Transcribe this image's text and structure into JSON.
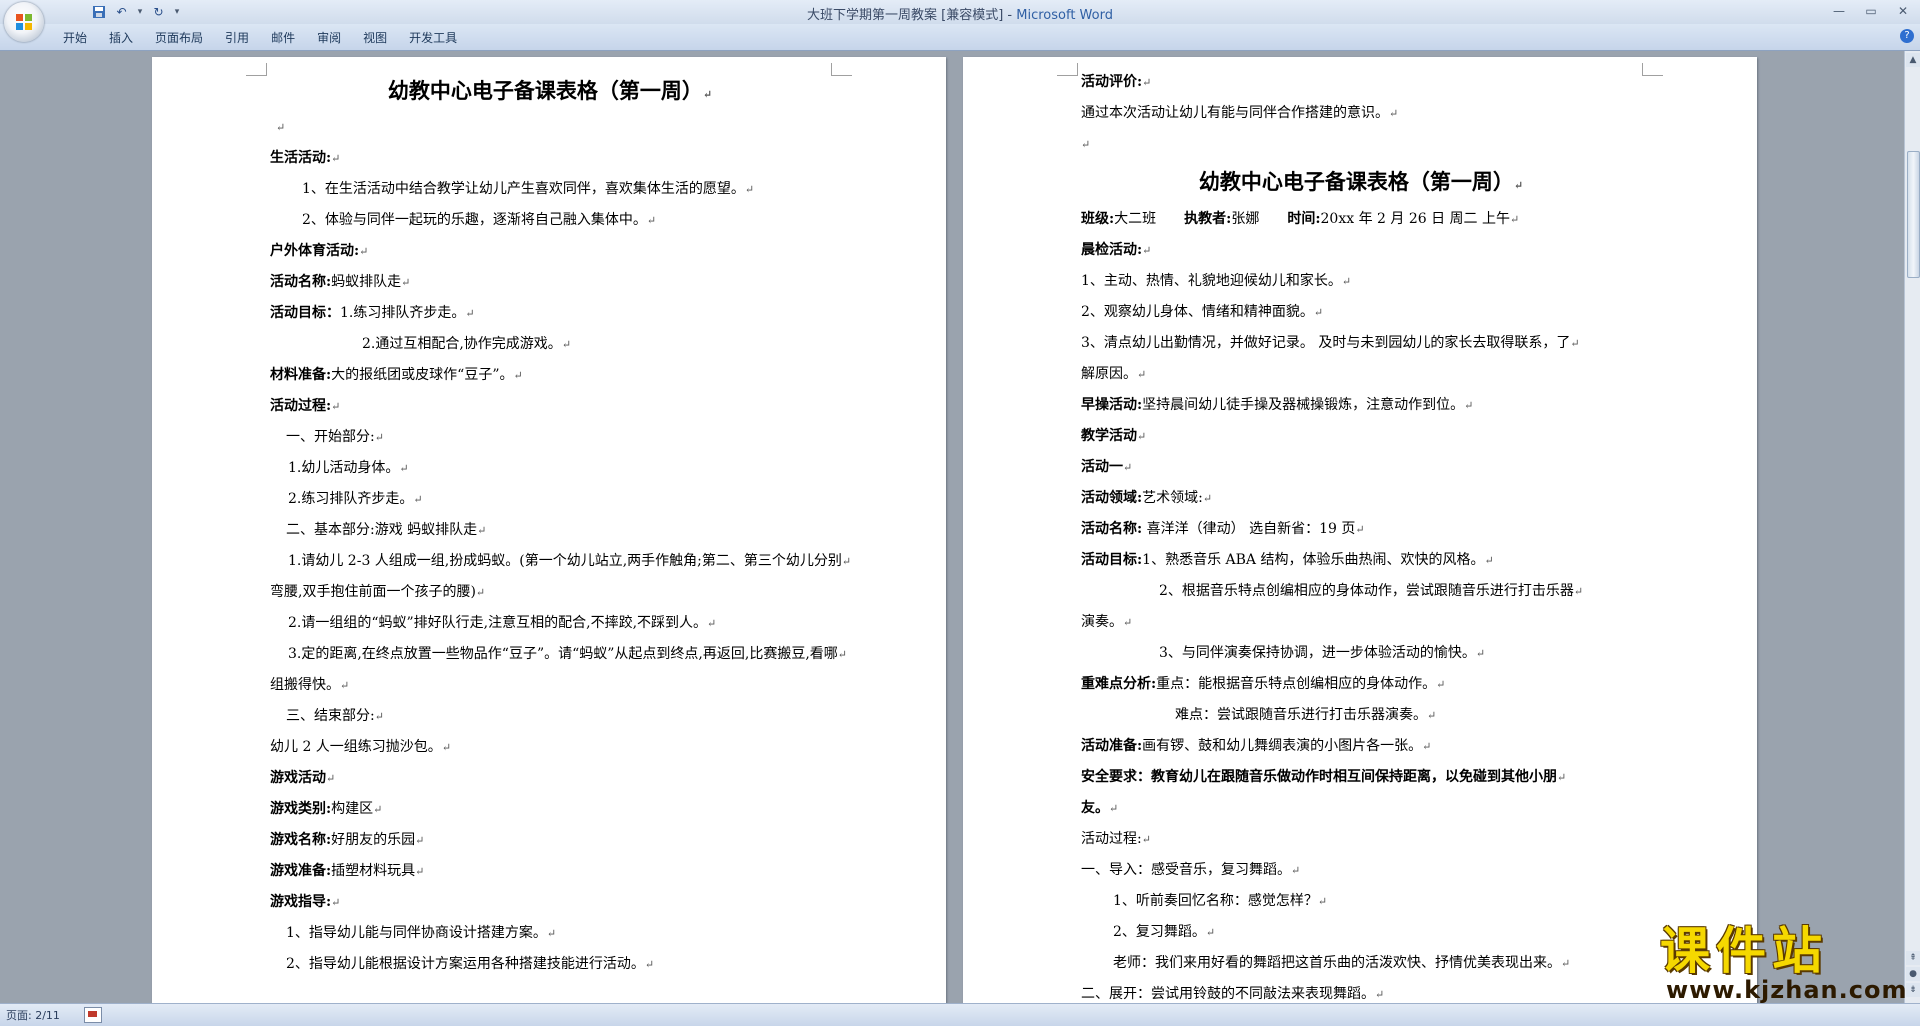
{
  "window": {
    "title_doc": "大班下学期第一周教案 [兼容模式] -",
    "title_app": "Microsoft Word"
  },
  "ribbon": {
    "tabs": [
      "开始",
      "插入",
      "页面布局",
      "引用",
      "邮件",
      "审阅",
      "视图",
      "开发工具"
    ]
  },
  "status": {
    "page": "页面: 2/11"
  },
  "page_left": {
    "title": "幼教中心电子备课表格（第一周）",
    "lines": [
      {
        "t": "",
        "b": false,
        "indent": 6
      },
      {
        "t": "生活活动:",
        "b": true,
        "indent": 0
      },
      {
        "t": "1、在生活活动中结合教学让幼儿产生喜欢同伴，喜欢集体生活的愿望。",
        "b": false,
        "indent": 32
      },
      {
        "t": "2、体验与同伴一起玩的乐趣，逐渐将自己融入集体中。",
        "b": false,
        "indent": 32
      },
      {
        "t": "户外体育活动:",
        "b": true,
        "indent": 0
      },
      {
        "t_b": "活动名称:",
        "t": "蚂蚁排队走",
        "indent": 0
      },
      {
        "t_b": "活动目标：",
        "t": "1.练习排队齐步走。",
        "indent": 0
      },
      {
        "t": "2.通过互相配合,协作完成游戏。",
        "b": false,
        "indent": 92
      },
      {
        "t_b": "材料准备:",
        "t": "大的报纸团或皮球作“豆子”。",
        "indent": 0
      },
      {
        "t": "活动过程:",
        "b": true,
        "indent": 0
      },
      {
        "t": "一、开始部分:",
        "b": false,
        "indent": 16
      },
      {
        "t": "1.幼儿活动身体。",
        "b": false,
        "indent": 18
      },
      {
        "t": "2.练习排队齐步走。",
        "b": false,
        "indent": 18
      },
      {
        "t": "二、基本部分:游戏 蚂蚁排队走",
        "b": false,
        "indent": 16
      },
      {
        "t": "1.请幼儿 2-3 人组成一组,扮成蚂蚁。(第一个幼儿站立,两手作触角;第二、第三个幼儿分别",
        "b": false,
        "indent": 18
      },
      {
        "t": "弯腰,双手抱住前面一个孩子的腰)",
        "b": false,
        "indent": 0
      },
      {
        "t": "2.请一组组的“蚂蚁”排好队行走,注意互相的配合,不摔跤,不踩到人。",
        "b": false,
        "indent": 18
      },
      {
        "t": "3.定的距离,在终点放置一些物品作“豆子”。请“蚂蚁”从起点到终点,再返回,比赛搬豆,看哪",
        "b": false,
        "indent": 18
      },
      {
        "t": "组搬得快。",
        "b": false,
        "indent": 0
      },
      {
        "t": "三、结束部分:",
        "b": false,
        "indent": 16
      },
      {
        "t": "幼儿 2 人一组练习抛沙包。",
        "b": false,
        "indent": 0
      },
      {
        "t": "游戏活动",
        "b": true,
        "indent": 0
      },
      {
        "t_b": "游戏类别:",
        "t": "构建区",
        "indent": 0
      },
      {
        "t_b": "游戏名称:",
        "t": "好朋友的乐园",
        "indent": 0
      },
      {
        "t_b": "游戏准备:",
        "t": "插塑材料玩具",
        "indent": 0
      },
      {
        "t": "游戏指导:",
        "b": true,
        "indent": 0
      },
      {
        "t": "1、指导幼儿能与同伴协商设计搭建方案。",
        "b": false,
        "indent": 16
      },
      {
        "t": "2、指导幼儿能根据设计方案运用各种搭建技能进行活动。",
        "b": false,
        "indent": 16
      }
    ]
  },
  "page_right": {
    "lines_top": [
      {
        "t": "活动评价:",
        "b": true,
        "indent": 0
      },
      {
        "t": "通过本次活动让幼儿有能与同伴合作搭建的意识。",
        "b": false,
        "indent": 0
      },
      {
        "t": "",
        "b": false,
        "indent": 0
      }
    ],
    "title": "幼教中心电子备课表格（第一周）",
    "lines": [
      {
        "t_b": "班级:",
        "t": "大二班",
        "t_b2": "执教者:",
        "t2": "张娜",
        "t_b3": "时间:",
        "t3": "20xx 年 2 月 26 日   周二   上午",
        "indent": 0
      },
      {
        "t": "晨检活动:",
        "b": true,
        "indent": 0
      },
      {
        "t": "1、主动、热情、礼貌地迎候幼儿和家长。",
        "b": false,
        "indent": 0
      },
      {
        "t": "2、观察幼儿身体、情绪和精神面貌。",
        "b": false,
        "indent": 0
      },
      {
        "t": "3、清点幼儿出勤情况，并做好记录。 及时与未到园幼儿的家长去取得联系，了",
        "b": false,
        "indent": 0
      },
      {
        "t": "解原因。",
        "b": false,
        "indent": 0
      },
      {
        "t_b": "早操活动:",
        "t": "坚持晨间幼儿徒手操及器械操锻炼，注意动作到位。",
        "indent": 0
      },
      {
        "t": "教学活动",
        "b": true,
        "indent": 0
      },
      {
        "t": "活动一",
        "b": true,
        "indent": 0
      },
      {
        "t_b": "活动领域:",
        "t": "艺术领域:",
        "indent": 0
      },
      {
        "t_b": "活动名称:",
        "t": "  喜洋洋（律动）     选自新省：19 页",
        "indent": 0
      },
      {
        "t_b": "活动目标:",
        "t": "1、熟悉音乐 ABA 结构，体验乐曲热闹、欢快的风格。",
        "indent": 0
      },
      {
        "t": "2、根据音乐特点创编相应的身体动作，尝试跟随音乐进行打击乐器",
        "b": false,
        "indent": 78
      },
      {
        "t": "演奏。",
        "b": false,
        "indent": 0
      },
      {
        "t": "3、与同伴演奏保持协调，进一步体验活动的愉快。",
        "b": false,
        "indent": 78
      },
      {
        "t_b": "重难点分析:",
        "t": "重点：能根据音乐特点创编相应的身体动作。",
        "indent": 0
      },
      {
        "t": "难点：尝试跟随音乐进行打击乐器演奏。",
        "b": false,
        "indent": 94
      },
      {
        "t_b": "活动准备:",
        "t": "画有锣、鼓和幼儿舞绸表演的小图片各一张。",
        "indent": 0
      },
      {
        "t": "安全要求：教育幼儿在跟随音乐做动作时相互间保持距离，以免碰到其他小朋",
        "b": true,
        "indent": 0
      },
      {
        "t": "友。",
        "b": true,
        "indent": 0
      },
      {
        "t": "活动过程:",
        "b": false,
        "indent": 0
      },
      {
        "t": "一、导入：感受音乐，复习舞蹈。",
        "b": false,
        "indent": 0
      },
      {
        "t": "1、听前奏回忆名称：感觉怎样？",
        "b": false,
        "indent": 32
      },
      {
        "t": "2、复习舞蹈。",
        "b": false,
        "indent": 32
      },
      {
        "t": "老师：我们来用好看的舞蹈把这首乐曲的活泼欢快、抒情优美表现出来。",
        "b": false,
        "indent": 32
      },
      {
        "t": "二、展开：尝试用铃鼓的不同敲法来表现舞蹈。",
        "b": false,
        "indent": 0
      }
    ]
  },
  "watermark": {
    "cn": "课件站",
    "url": "www.kjzhan.com"
  },
  "colors": {
    "workspace": "#9aa3ae",
    "ribbon": "#c6d5ea",
    "accent": "#2f5fa4"
  }
}
